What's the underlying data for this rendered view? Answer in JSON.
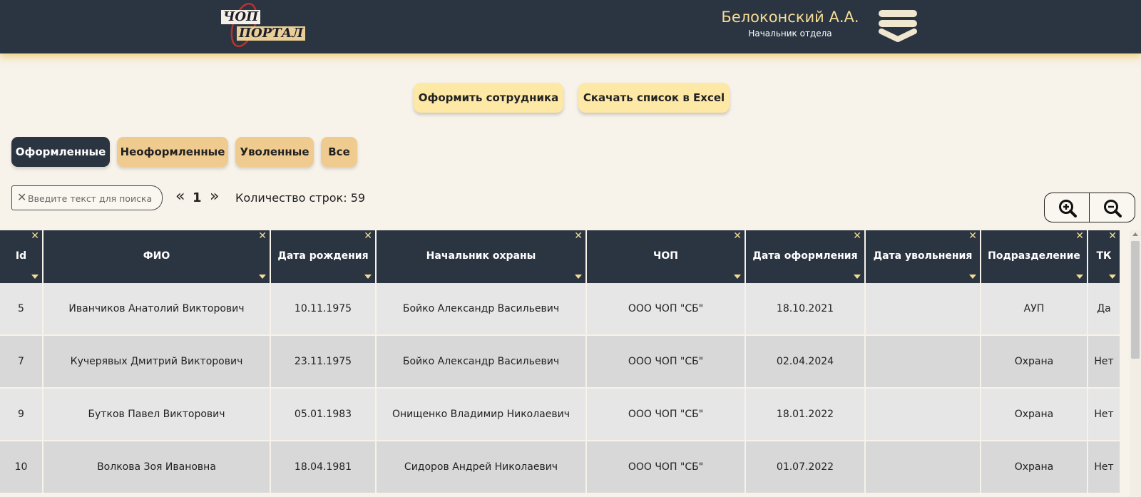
{
  "header": {
    "logo_top": "ЧОП",
    "logo_bottom": "ПОРТАЛ",
    "user_name": "Белоконский А.А.",
    "user_role": "Начальник отдела",
    "menu_icon": "hamburger-chevron-icon"
  },
  "actions": {
    "register_employee": "Оформить сотрудника",
    "download_excel": "Скачать список в Excel"
  },
  "tabs": [
    {
      "label": "Оформленные",
      "active": true
    },
    {
      "label": "Неоформленные",
      "active": false
    },
    {
      "label": "Уволенные",
      "active": false
    },
    {
      "label": "Все",
      "active": false
    }
  ],
  "search": {
    "placeholder": "Введите текст для поиска",
    "value": ""
  },
  "pager": {
    "prev": "«",
    "page": "1",
    "next": "»"
  },
  "rows_count": "Количество строк: 59",
  "zoom": {
    "in_icon": "zoom-in-icon",
    "out_icon": "zoom-out-icon"
  },
  "table": {
    "columns": [
      "Id",
      "ФИО",
      "Дата рождения",
      "Начальник охраны",
      "ЧОП",
      "Дата оформления",
      "Дата увольнения",
      "Подразделение",
      "ТК"
    ],
    "rows": [
      [
        "5",
        "Иванчиков Анатолий Викторович",
        "10.11.1975",
        "Бойко Александр Васильевич",
        "ООО ЧОП \"СБ\"",
        "18.10.2021",
        "",
        "АУП",
        "Да"
      ],
      [
        "7",
        "Кучерявых Дмитрий Викторович",
        "23.11.1975",
        "Бойко Александр Васильевич",
        "ООО ЧОП \"СБ\"",
        "02.04.2024",
        "",
        "Охрана",
        "Нет"
      ],
      [
        "9",
        "Бутков Павел Викторович",
        "05.01.1983",
        "Онищенко Владимир Николаевич",
        "ООО ЧОП \"СБ\"",
        "18.01.2022",
        "",
        "Охрана",
        "Нет"
      ],
      [
        "10",
        "Волкова Зоя Ивановна",
        "18.04.1981",
        "Сидоров Андрей Николаевич",
        "ООО ЧОП \"СБ\"",
        "01.07.2022",
        "",
        "Охрана",
        "Нет"
      ]
    ]
  },
  "colors": {
    "header_bg": "#2b3441",
    "accent_gold": "#f5dc96",
    "button_yellow": "#fde9a5",
    "tab_orange": "#f0cb8f",
    "page_bg": "#f7f2ea"
  }
}
